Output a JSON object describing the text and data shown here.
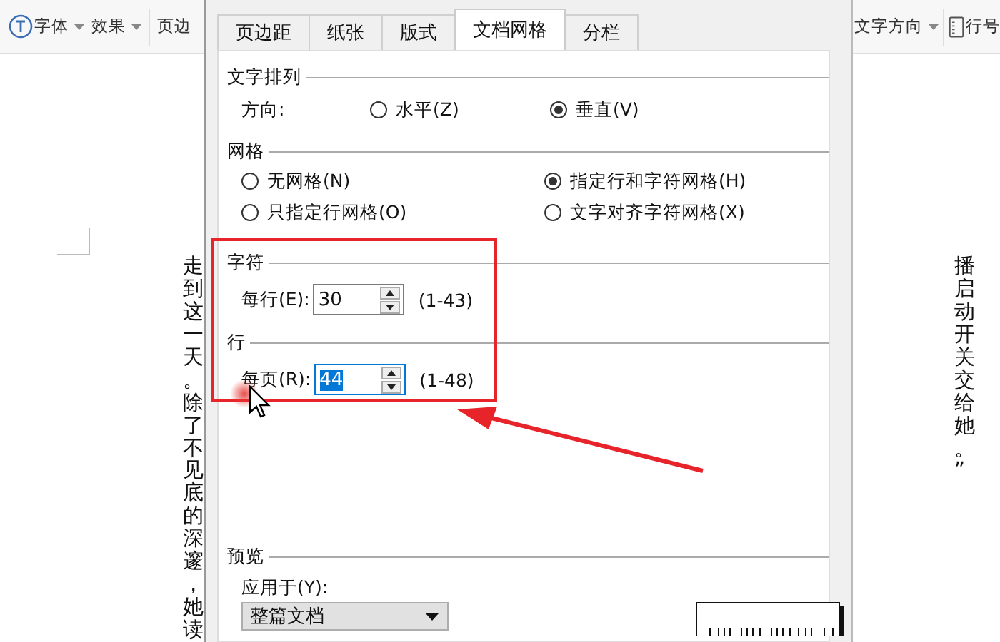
{
  "toolbar": {
    "left": [
      {
        "label": "字体",
        "kind": "font"
      },
      {
        "label": "效果",
        "kind": "menu"
      },
      {
        "label": "页边",
        "kind": "plain"
      }
    ],
    "right": [
      {
        "label": "文字方向",
        "kind": "menu"
      },
      {
        "label": "行号",
        "kind": "lines"
      }
    ]
  },
  "document": {
    "columns": [
      "走到这一天。除了不见底的深邃，她读",
      "播启动开关交给她。”"
    ]
  },
  "dialog": {
    "tabs": [
      {
        "label": "页边距",
        "selected": false
      },
      {
        "label": "纸张",
        "selected": false
      },
      {
        "label": "版式",
        "selected": false
      },
      {
        "label": "文档网格",
        "selected": true
      },
      {
        "label": "分栏",
        "selected": false
      }
    ],
    "text_direction": {
      "title": "文字排列",
      "label": "方向:",
      "options": [
        {
          "label": "水平(Z)",
          "selected": false
        },
        {
          "label": "垂直(V)",
          "selected": true
        }
      ]
    },
    "grid": {
      "title": "网格",
      "options": [
        {
          "label": "无网格(N)",
          "selected": false
        },
        {
          "label": "指定行和字符网格(H)",
          "selected": true
        },
        {
          "label": "只指定行网格(O)",
          "selected": false
        },
        {
          "label": "文字对齐字符网格(X)",
          "selected": false
        }
      ]
    },
    "characters": {
      "title": "字符",
      "label": "每行(E):",
      "value": "30",
      "range": "(1-43)",
      "focused": false
    },
    "lines": {
      "title": "行",
      "label": "每页(R):",
      "value": "44",
      "range": "(1-48)",
      "focused": true
    },
    "preview": {
      "title": "预览",
      "apply_label": "应用于(Y):",
      "apply_value": "整篇文档"
    }
  }
}
